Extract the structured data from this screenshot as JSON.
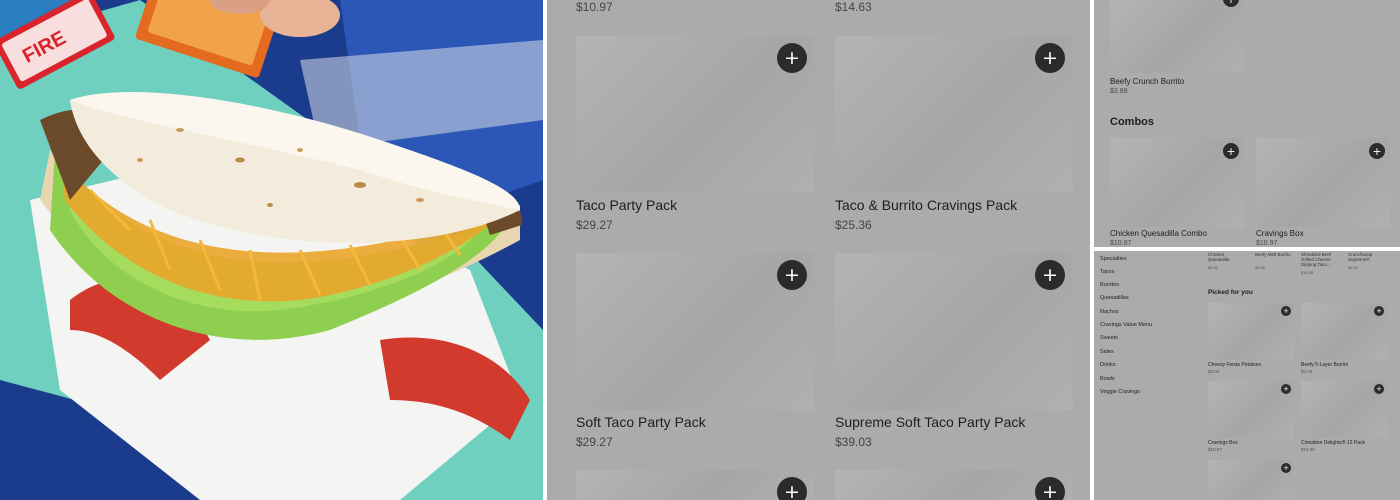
{
  "photo": {
    "description_icon": "taco-photo",
    "packet_text": "FIRE"
  },
  "grid": {
    "top_prices": [
      "$10.97",
      "$14.63"
    ],
    "items": [
      {
        "name": "Taco Party Pack",
        "price": "$29.27"
      },
      {
        "name": "Taco & Burrito Cravings Pack",
        "price": "$25.36"
      },
      {
        "name": "Soft Taco Party Pack",
        "price": "$29.27"
      },
      {
        "name": "Supreme Soft Taco Party Pack",
        "price": "$39.03"
      }
    ],
    "add_label": "+"
  },
  "rtop": {
    "item": {
      "name": "Beefy Crunch Burrito",
      "price": "$3.89"
    },
    "section_title": "Combos",
    "combos": [
      {
        "name": "Chicken Quesadilla Combo",
        "price": "$10.97"
      },
      {
        "name": "Cravings Box",
        "price": "$10.97"
      }
    ],
    "add_label": "+"
  },
  "rbot": {
    "nav": [
      "Specialties",
      "Tacos",
      "Burritos",
      "Quesadillas",
      "Nachos",
      "Cravings Value Menu",
      "Sweets",
      "Sides",
      "Drinks",
      "Bowls",
      "Veggie Cravings"
    ],
    "top_row": [
      {
        "name": "Chicken Quesadilla",
        "price": "$6.82"
      },
      {
        "name": "Beefy Melt Burrito",
        "price": "$2.66"
      },
      {
        "name": "Shredded Beef Grilled Cheese Dipping Taco...",
        "price": "$10.85"
      },
      {
        "name": "Crunchwrap Supreme®",
        "price": "$6.94"
      }
    ],
    "section_title": "Picked for you",
    "items": [
      {
        "name": "Cheesy Fiesta Potatoes",
        "price": "$3.04"
      },
      {
        "name": "Beefy 5-Layer Burrito",
        "price": "$4.75"
      },
      {
        "name": "Cravings Box",
        "price": "$10.97"
      },
      {
        "name": "Cinnabon Delights® 12 Pack",
        "price": "$10.95"
      }
    ],
    "add_label": "+"
  }
}
